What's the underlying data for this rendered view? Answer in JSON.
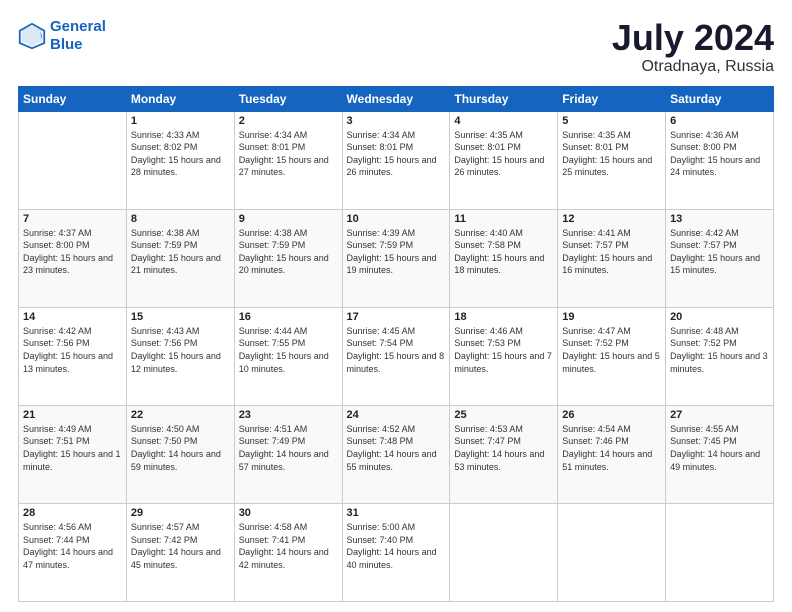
{
  "header": {
    "logo_line1": "General",
    "logo_line2": "Blue",
    "title": "July 2024",
    "location": "Otradnaya, Russia"
  },
  "days_of_week": [
    "Sunday",
    "Monday",
    "Tuesday",
    "Wednesday",
    "Thursday",
    "Friday",
    "Saturday"
  ],
  "weeks": [
    [
      null,
      {
        "day": 1,
        "sunrise": "4:33 AM",
        "sunset": "8:02 PM",
        "daylight": "15 hours and 28 minutes."
      },
      {
        "day": 2,
        "sunrise": "4:34 AM",
        "sunset": "8:01 PM",
        "daylight": "15 hours and 27 minutes."
      },
      {
        "day": 3,
        "sunrise": "4:34 AM",
        "sunset": "8:01 PM",
        "daylight": "15 hours and 26 minutes."
      },
      {
        "day": 4,
        "sunrise": "4:35 AM",
        "sunset": "8:01 PM",
        "daylight": "15 hours and 26 minutes."
      },
      {
        "day": 5,
        "sunrise": "4:35 AM",
        "sunset": "8:01 PM",
        "daylight": "15 hours and 25 minutes."
      },
      {
        "day": 6,
        "sunrise": "4:36 AM",
        "sunset": "8:00 PM",
        "daylight": "15 hours and 24 minutes."
      }
    ],
    [
      {
        "day": 7,
        "sunrise": "4:37 AM",
        "sunset": "8:00 PM",
        "daylight": "15 hours and 23 minutes."
      },
      {
        "day": 8,
        "sunrise": "4:38 AM",
        "sunset": "7:59 PM",
        "daylight": "15 hours and 21 minutes."
      },
      {
        "day": 9,
        "sunrise": "4:38 AM",
        "sunset": "7:59 PM",
        "daylight": "15 hours and 20 minutes."
      },
      {
        "day": 10,
        "sunrise": "4:39 AM",
        "sunset": "7:59 PM",
        "daylight": "15 hours and 19 minutes."
      },
      {
        "day": 11,
        "sunrise": "4:40 AM",
        "sunset": "7:58 PM",
        "daylight": "15 hours and 18 minutes."
      },
      {
        "day": 12,
        "sunrise": "4:41 AM",
        "sunset": "7:57 PM",
        "daylight": "15 hours and 16 minutes."
      },
      {
        "day": 13,
        "sunrise": "4:42 AM",
        "sunset": "7:57 PM",
        "daylight": "15 hours and 15 minutes."
      }
    ],
    [
      {
        "day": 14,
        "sunrise": "4:42 AM",
        "sunset": "7:56 PM",
        "daylight": "15 hours and 13 minutes."
      },
      {
        "day": 15,
        "sunrise": "4:43 AM",
        "sunset": "7:56 PM",
        "daylight": "15 hours and 12 minutes."
      },
      {
        "day": 16,
        "sunrise": "4:44 AM",
        "sunset": "7:55 PM",
        "daylight": "15 hours and 10 minutes."
      },
      {
        "day": 17,
        "sunrise": "4:45 AM",
        "sunset": "7:54 PM",
        "daylight": "15 hours and 8 minutes."
      },
      {
        "day": 18,
        "sunrise": "4:46 AM",
        "sunset": "7:53 PM",
        "daylight": "15 hours and 7 minutes."
      },
      {
        "day": 19,
        "sunrise": "4:47 AM",
        "sunset": "7:52 PM",
        "daylight": "15 hours and 5 minutes."
      },
      {
        "day": 20,
        "sunrise": "4:48 AM",
        "sunset": "7:52 PM",
        "daylight": "15 hours and 3 minutes."
      }
    ],
    [
      {
        "day": 21,
        "sunrise": "4:49 AM",
        "sunset": "7:51 PM",
        "daylight": "15 hours and 1 minute."
      },
      {
        "day": 22,
        "sunrise": "4:50 AM",
        "sunset": "7:50 PM",
        "daylight": "14 hours and 59 minutes."
      },
      {
        "day": 23,
        "sunrise": "4:51 AM",
        "sunset": "7:49 PM",
        "daylight": "14 hours and 57 minutes."
      },
      {
        "day": 24,
        "sunrise": "4:52 AM",
        "sunset": "7:48 PM",
        "daylight": "14 hours and 55 minutes."
      },
      {
        "day": 25,
        "sunrise": "4:53 AM",
        "sunset": "7:47 PM",
        "daylight": "14 hours and 53 minutes."
      },
      {
        "day": 26,
        "sunrise": "4:54 AM",
        "sunset": "7:46 PM",
        "daylight": "14 hours and 51 minutes."
      },
      {
        "day": 27,
        "sunrise": "4:55 AM",
        "sunset": "7:45 PM",
        "daylight": "14 hours and 49 minutes."
      }
    ],
    [
      {
        "day": 28,
        "sunrise": "4:56 AM",
        "sunset": "7:44 PM",
        "daylight": "14 hours and 47 minutes."
      },
      {
        "day": 29,
        "sunrise": "4:57 AM",
        "sunset": "7:42 PM",
        "daylight": "14 hours and 45 minutes."
      },
      {
        "day": 30,
        "sunrise": "4:58 AM",
        "sunset": "7:41 PM",
        "daylight": "14 hours and 42 minutes."
      },
      {
        "day": 31,
        "sunrise": "5:00 AM",
        "sunset": "7:40 PM",
        "daylight": "14 hours and 40 minutes."
      },
      null,
      null,
      null
    ]
  ]
}
